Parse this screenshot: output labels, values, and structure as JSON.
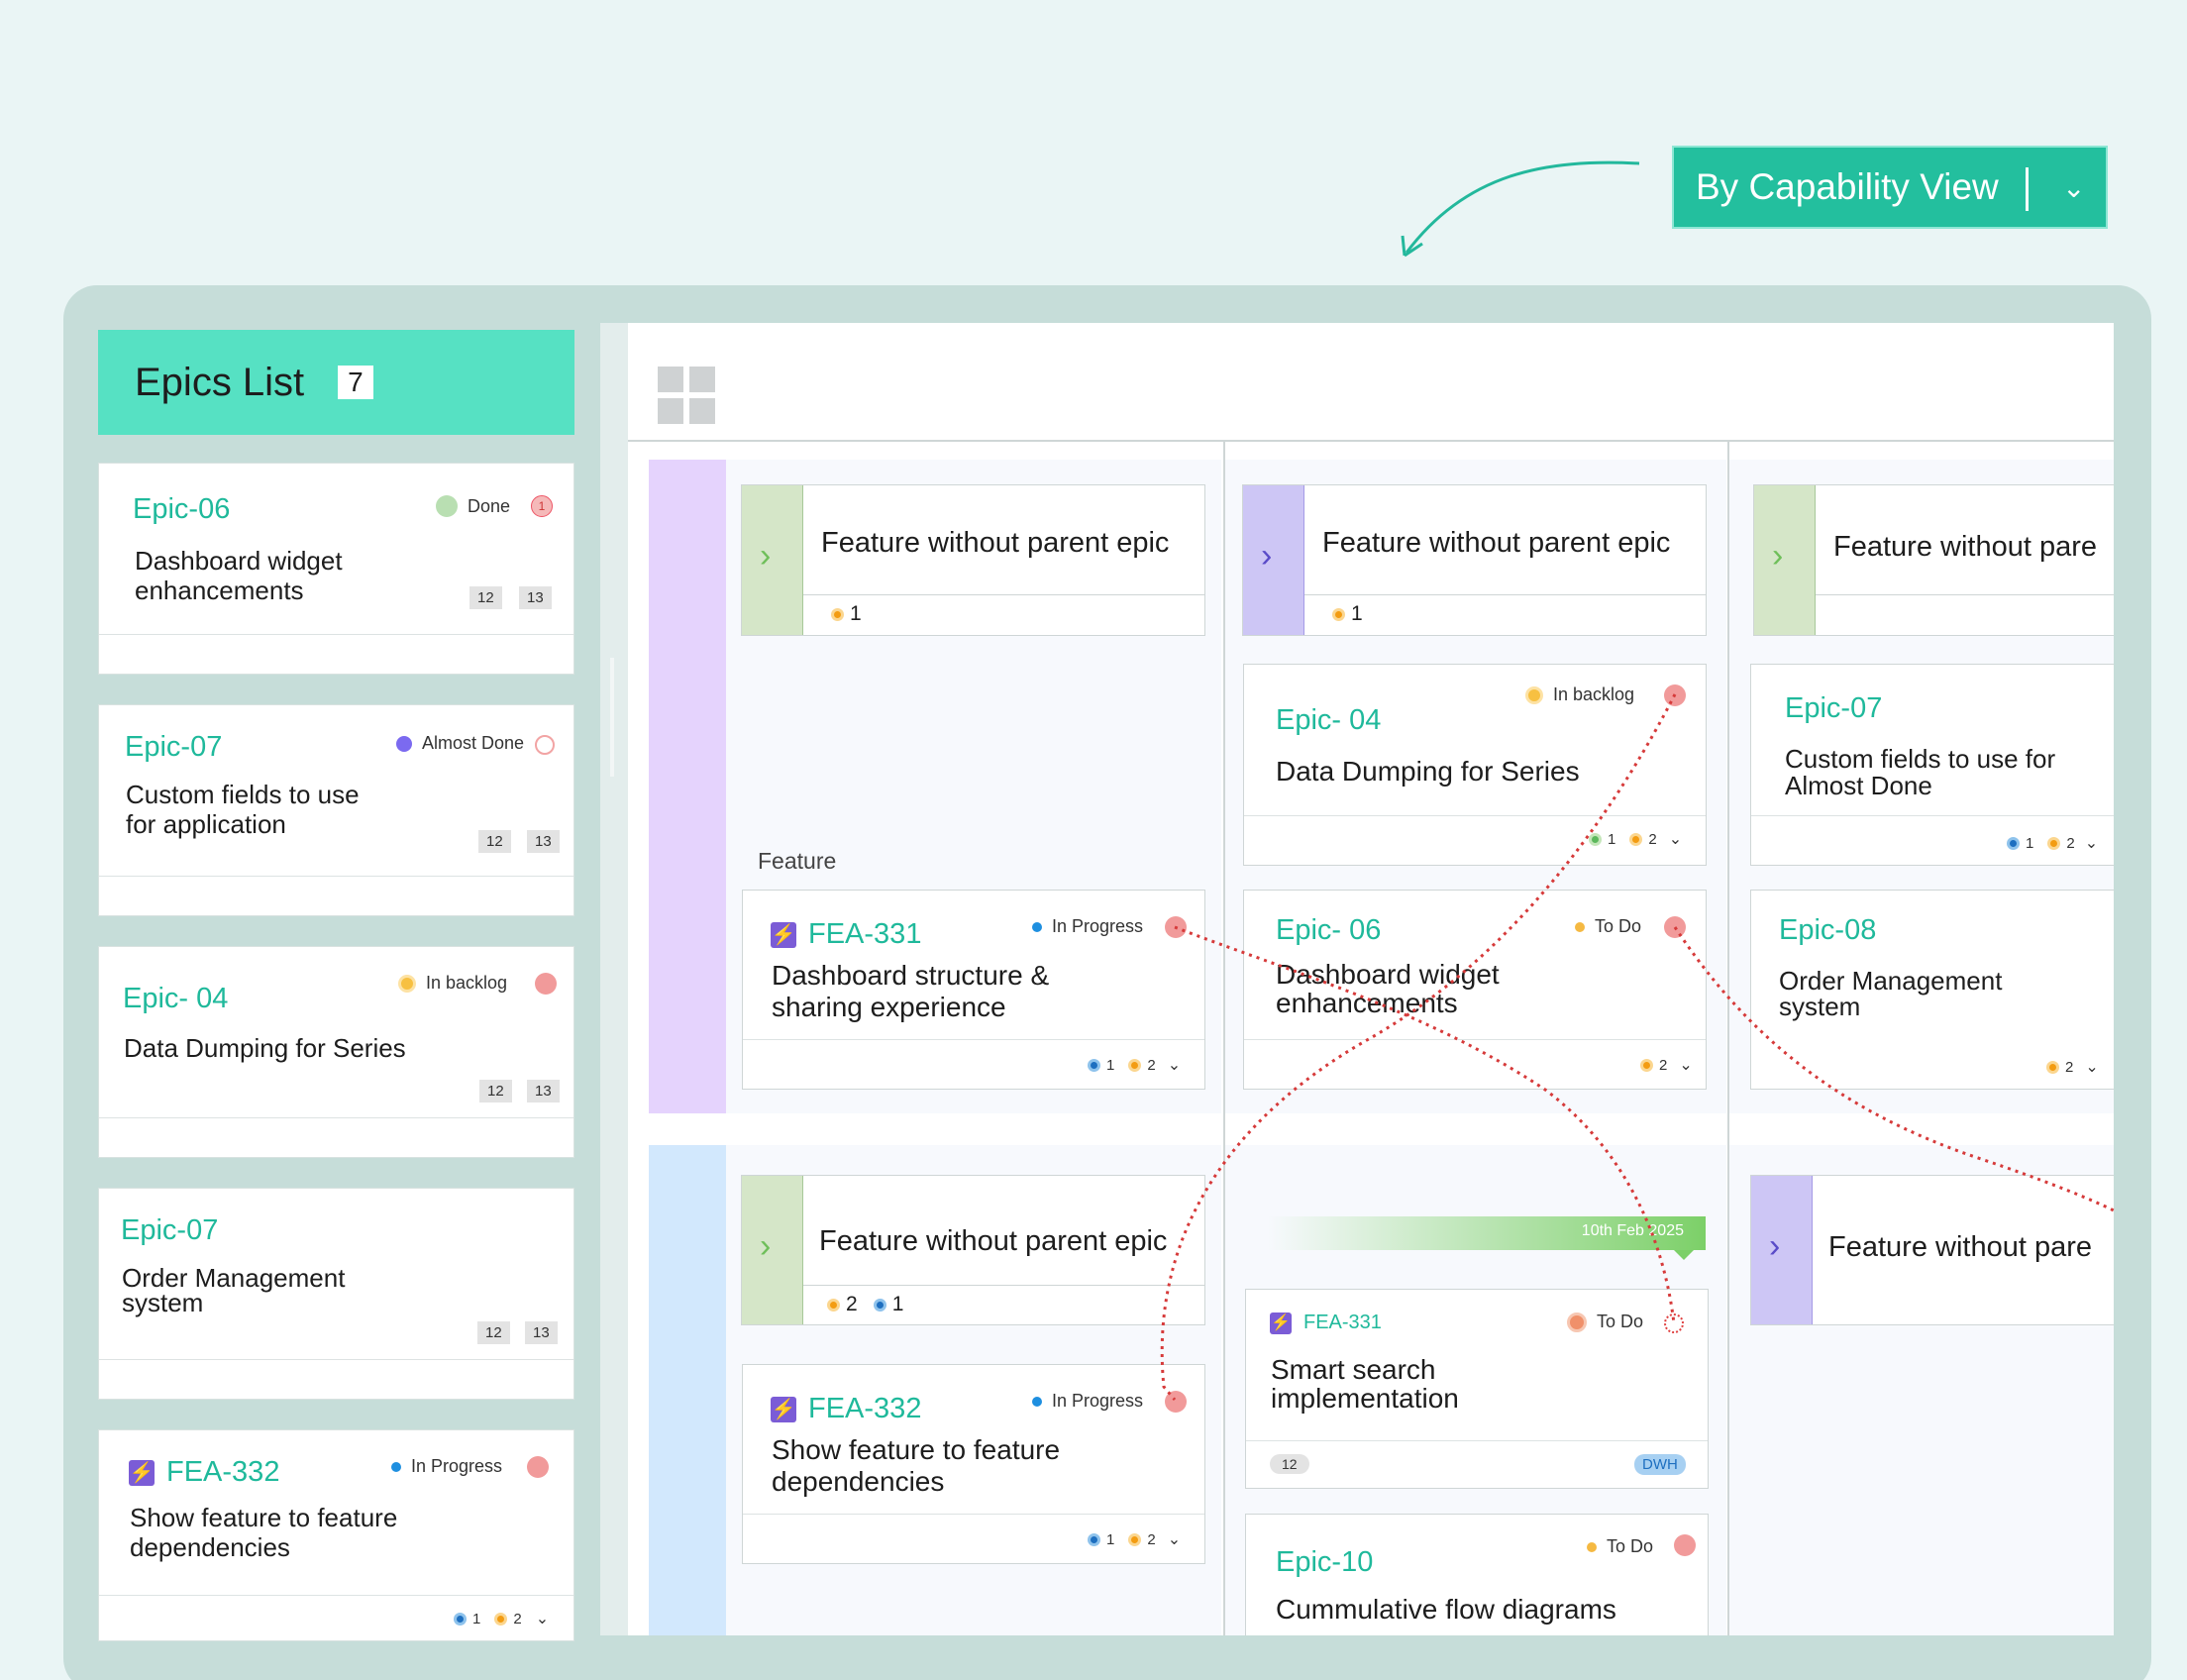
{
  "view_selector": {
    "label": "By Capability View"
  },
  "epics_list": {
    "title": "Epics List",
    "count": "7",
    "cards": [
      {
        "id": "Epic-06",
        "status": "Done",
        "title_line1": "Dashboard widget",
        "title_line2": "enhancements",
        "tag1": "12",
        "tag2": "13"
      },
      {
        "id": "Epic-07",
        "status": "Almost Done",
        "title_line1": "Custom fields to use",
        "title_line2": "for application",
        "tag1": "12",
        "tag2": "13"
      },
      {
        "id": "Epic- 04",
        "status": "In backlog",
        "title_line1": "Data Dumping for Series",
        "tag1": "12",
        "tag2": "13"
      },
      {
        "id": "Epic-07",
        "title_line1": "Order Management",
        "title_line2": "system",
        "tag1": "12",
        "tag2": "13"
      },
      {
        "id": "FEA-332",
        "status": "In Progress",
        "title_line1": "Show feature to feature",
        "title_line2": "dependencies",
        "count_blue": "1",
        "count_orange": "2"
      }
    ]
  },
  "board": {
    "section_label": "Feature",
    "feature_cards": {
      "r1c1": {
        "title": "Feature without parent epic",
        "count_orange": "1"
      },
      "r1c2": {
        "title": "Feature without parent epic",
        "count_orange": "1"
      },
      "r1c3": {
        "title": "Feature without pare"
      },
      "r2c1": {
        "title": "Feature without parent epic",
        "count_orange": "2",
        "count_blue": "1"
      },
      "r2c3": {
        "title": "Feature without pare"
      }
    },
    "cards": {
      "c1_fea331": {
        "id": "FEA-331",
        "status": "In Progress",
        "line1": "Dashboard structure &",
        "line2": "sharing experience",
        "count_blue": "1",
        "count_orange": "2"
      },
      "c1_fea332": {
        "id": "FEA-332",
        "status": "In Progress",
        "line1": "Show feature to feature",
        "line2": "dependencies",
        "count_blue": "1",
        "count_orange": "2"
      },
      "c2_epic04": {
        "id": "Epic- 04",
        "status": "In backlog",
        "line1": "Data Dumping for Series",
        "count_green": "1",
        "count_orange": "2"
      },
      "c2_epic06": {
        "id": "Epic- 06",
        "status": "To Do",
        "line1": "Dashboard widget",
        "line2": "enhancements",
        "count_orange": "2"
      },
      "c2_fea331": {
        "id": "FEA-331",
        "status": "To Do",
        "line1": "Smart search",
        "line2": "implementation",
        "tag": "12",
        "badge": "DWH"
      },
      "c2_epic10": {
        "id": "Epic-10",
        "status": "To Do",
        "line1": "Cummulative flow diagrams"
      },
      "c3_epic07": {
        "id": "Epic-07",
        "line1": "Custom fields to use for",
        "line2": "Almost Done",
        "count_blue": "1",
        "count_orange": "2"
      },
      "c3_epic08": {
        "id": "Epic-08",
        "line1": "Order Management",
        "line2": "system",
        "count_orange": "2"
      }
    },
    "timeline_label": "10th Feb 2025"
  },
  "colors": {
    "accent": "#23bf9e",
    "teal_text": "#1fb99b",
    "dependency": "#d63a3a",
    "lane_purple": "#e5d3fd",
    "lane_blue": "#d2e8fd"
  }
}
